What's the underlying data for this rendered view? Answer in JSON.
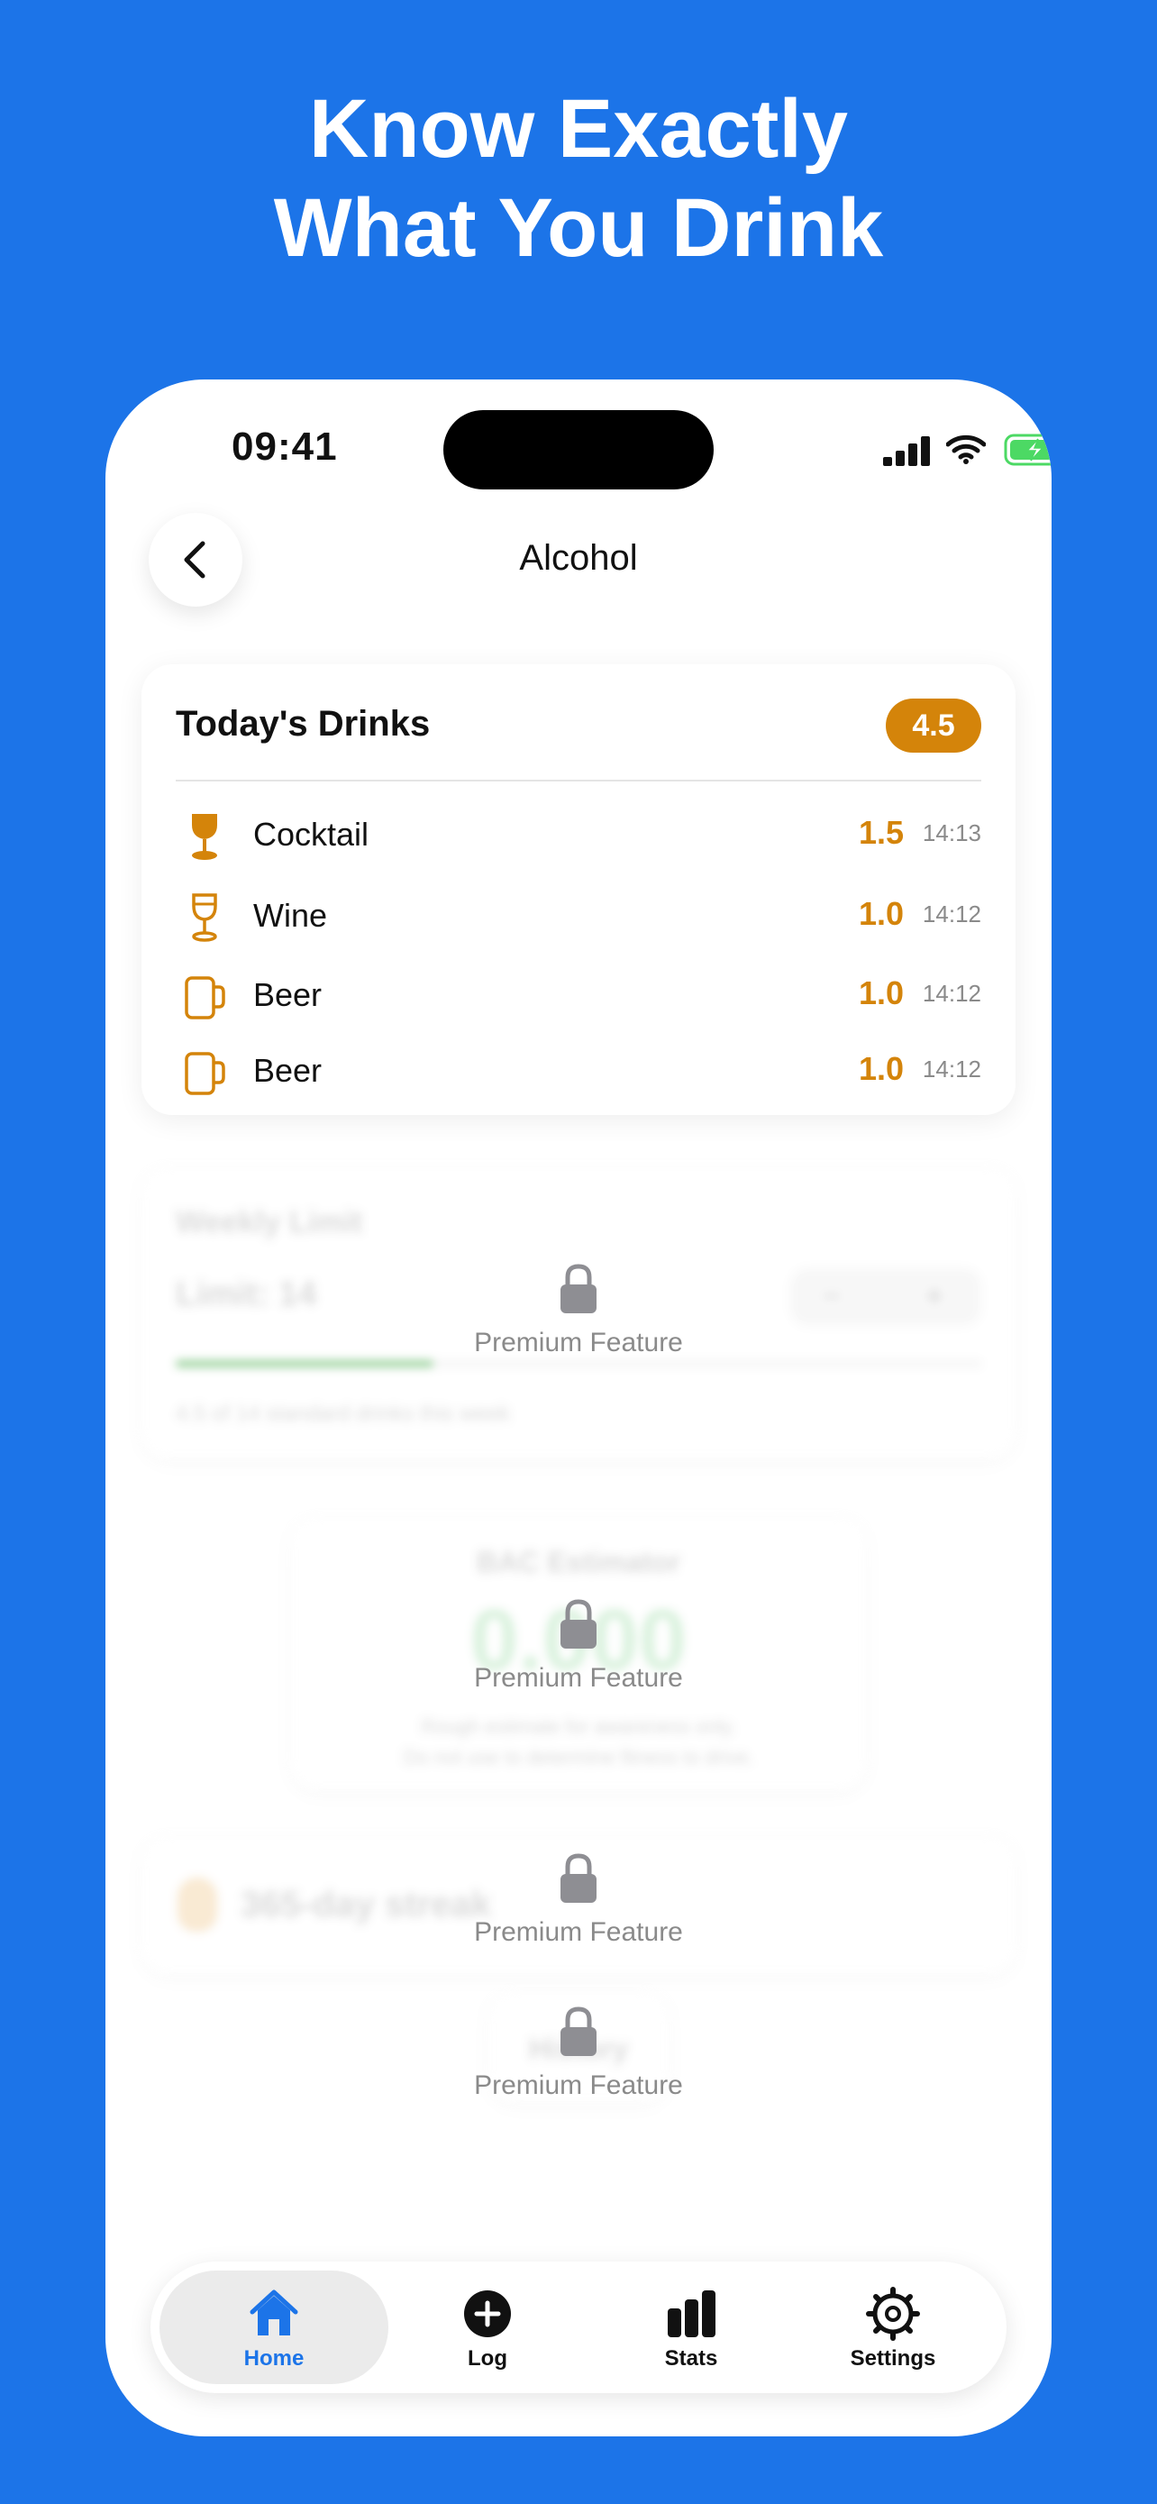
{
  "headline": {
    "line1": "Know Exactly",
    "line2": "What You Drink"
  },
  "status_bar": {
    "time": "09:41"
  },
  "nav": {
    "title": "Alcohol"
  },
  "today_card": {
    "title": "Today's Drinks",
    "total": "4.5",
    "drinks": [
      {
        "name": "Cocktail",
        "units": "1.5",
        "time": "14:13",
        "icon": "cocktail-glass-icon"
      },
      {
        "name": "Wine",
        "units": "1.0",
        "time": "14:12",
        "icon": "wine-glass-icon"
      },
      {
        "name": "Beer",
        "units": "1.0",
        "time": "14:12",
        "icon": "beer-mug-icon"
      },
      {
        "name": "Beer",
        "units": "1.0",
        "time": "14:12",
        "icon": "beer-mug-icon"
      }
    ]
  },
  "weekly_limit": {
    "title": "Weekly Limit",
    "limit_label": "Limit: 14",
    "decrement": "−",
    "increment": "+",
    "caption": "4.5 of 14 standard drinks this week",
    "premium_label": "Premium Feature"
  },
  "bac_estimator": {
    "title": "BAC Estimator",
    "value": "0.000",
    "note_line1": "Rough estimate for awareness only.",
    "note_line2": "Do not use to determine fitness to drive.",
    "premium_label": "Premium Feature"
  },
  "streak": {
    "label": "365-day streak",
    "premium_label": "Premium Feature"
  },
  "history": {
    "title": "History",
    "premium_label": "Premium Feature"
  },
  "tabbar": {
    "tabs": [
      {
        "label": "Home",
        "active": true
      },
      {
        "label": "Log",
        "active": false
      },
      {
        "label": "Stats",
        "active": false
      },
      {
        "label": "Settings",
        "active": false
      }
    ]
  },
  "colors": {
    "background": "#1c74e8",
    "accent": "#d4840a",
    "active_tab": "#1c74e8",
    "progress": "#4caf50"
  }
}
